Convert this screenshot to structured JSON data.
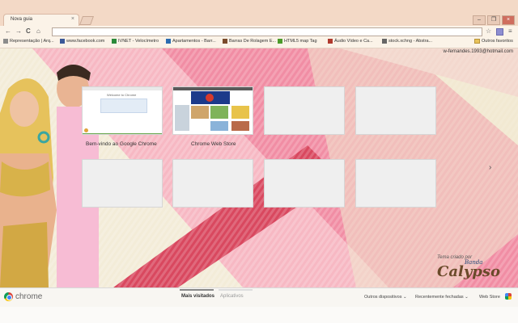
{
  "tab": {
    "title": "Nova guia",
    "close_glyph": "×"
  },
  "window_controls": {
    "minimize": "–",
    "restore": "❐",
    "close": "×"
  },
  "toolbar": {
    "back": "←",
    "forward": "→",
    "reload": "C",
    "home": "⌂",
    "star": "☆",
    "menu": "≡"
  },
  "bookmarks": [
    {
      "label": "Representação | Arq...",
      "icon_color": "#8c8c8c"
    },
    {
      "label": "www.facebook.com",
      "icon_color": "#3b5998"
    },
    {
      "label": "IVNET - Velocímetro",
      "icon_color": "#2a8a3a"
    },
    {
      "label": "Apartamentos - Barr...",
      "icon_color": "#2b6cb0"
    },
    {
      "label": "Barras De Rolagem E...",
      "icon_color": "#7a4a2a"
    },
    {
      "label": "HTML5 map Tag",
      "icon_color": "#4c9a2a"
    },
    {
      "label": "Áudio Vídeo e Ca...",
      "icon_color": "#b03a2e"
    },
    {
      "label": "stock.xchng - Abstra...",
      "icon_color": "#666666"
    }
  ],
  "other_bookmarks": "Outros favoritos",
  "user_email": "w-fernandes.1993@hotmail.com",
  "thumbnails": [
    {
      "title": "Bem-vindo ao Google Chrome",
      "preview_heading": "Welcome to Chrome"
    },
    {
      "title": "Chrome Web Store",
      "preview_heading": ""
    },
    {
      "title": ""
    },
    {
      "title": ""
    },
    {
      "title": ""
    },
    {
      "title": ""
    },
    {
      "title": ""
    },
    {
      "title": ""
    }
  ],
  "next_arrow": "›",
  "theme_credit": {
    "line1": "Tema criado por",
    "line2": "Banda",
    "line3": "Calypso"
  },
  "bottom_bar": {
    "logo_text": "chrome",
    "tabs": [
      "Mais visitados",
      "Aplicativos"
    ],
    "right_items": [
      "Outros dispositivos",
      "Recentemente fechadas",
      "Web Store"
    ],
    "dropdown_glyph": "⌄"
  }
}
